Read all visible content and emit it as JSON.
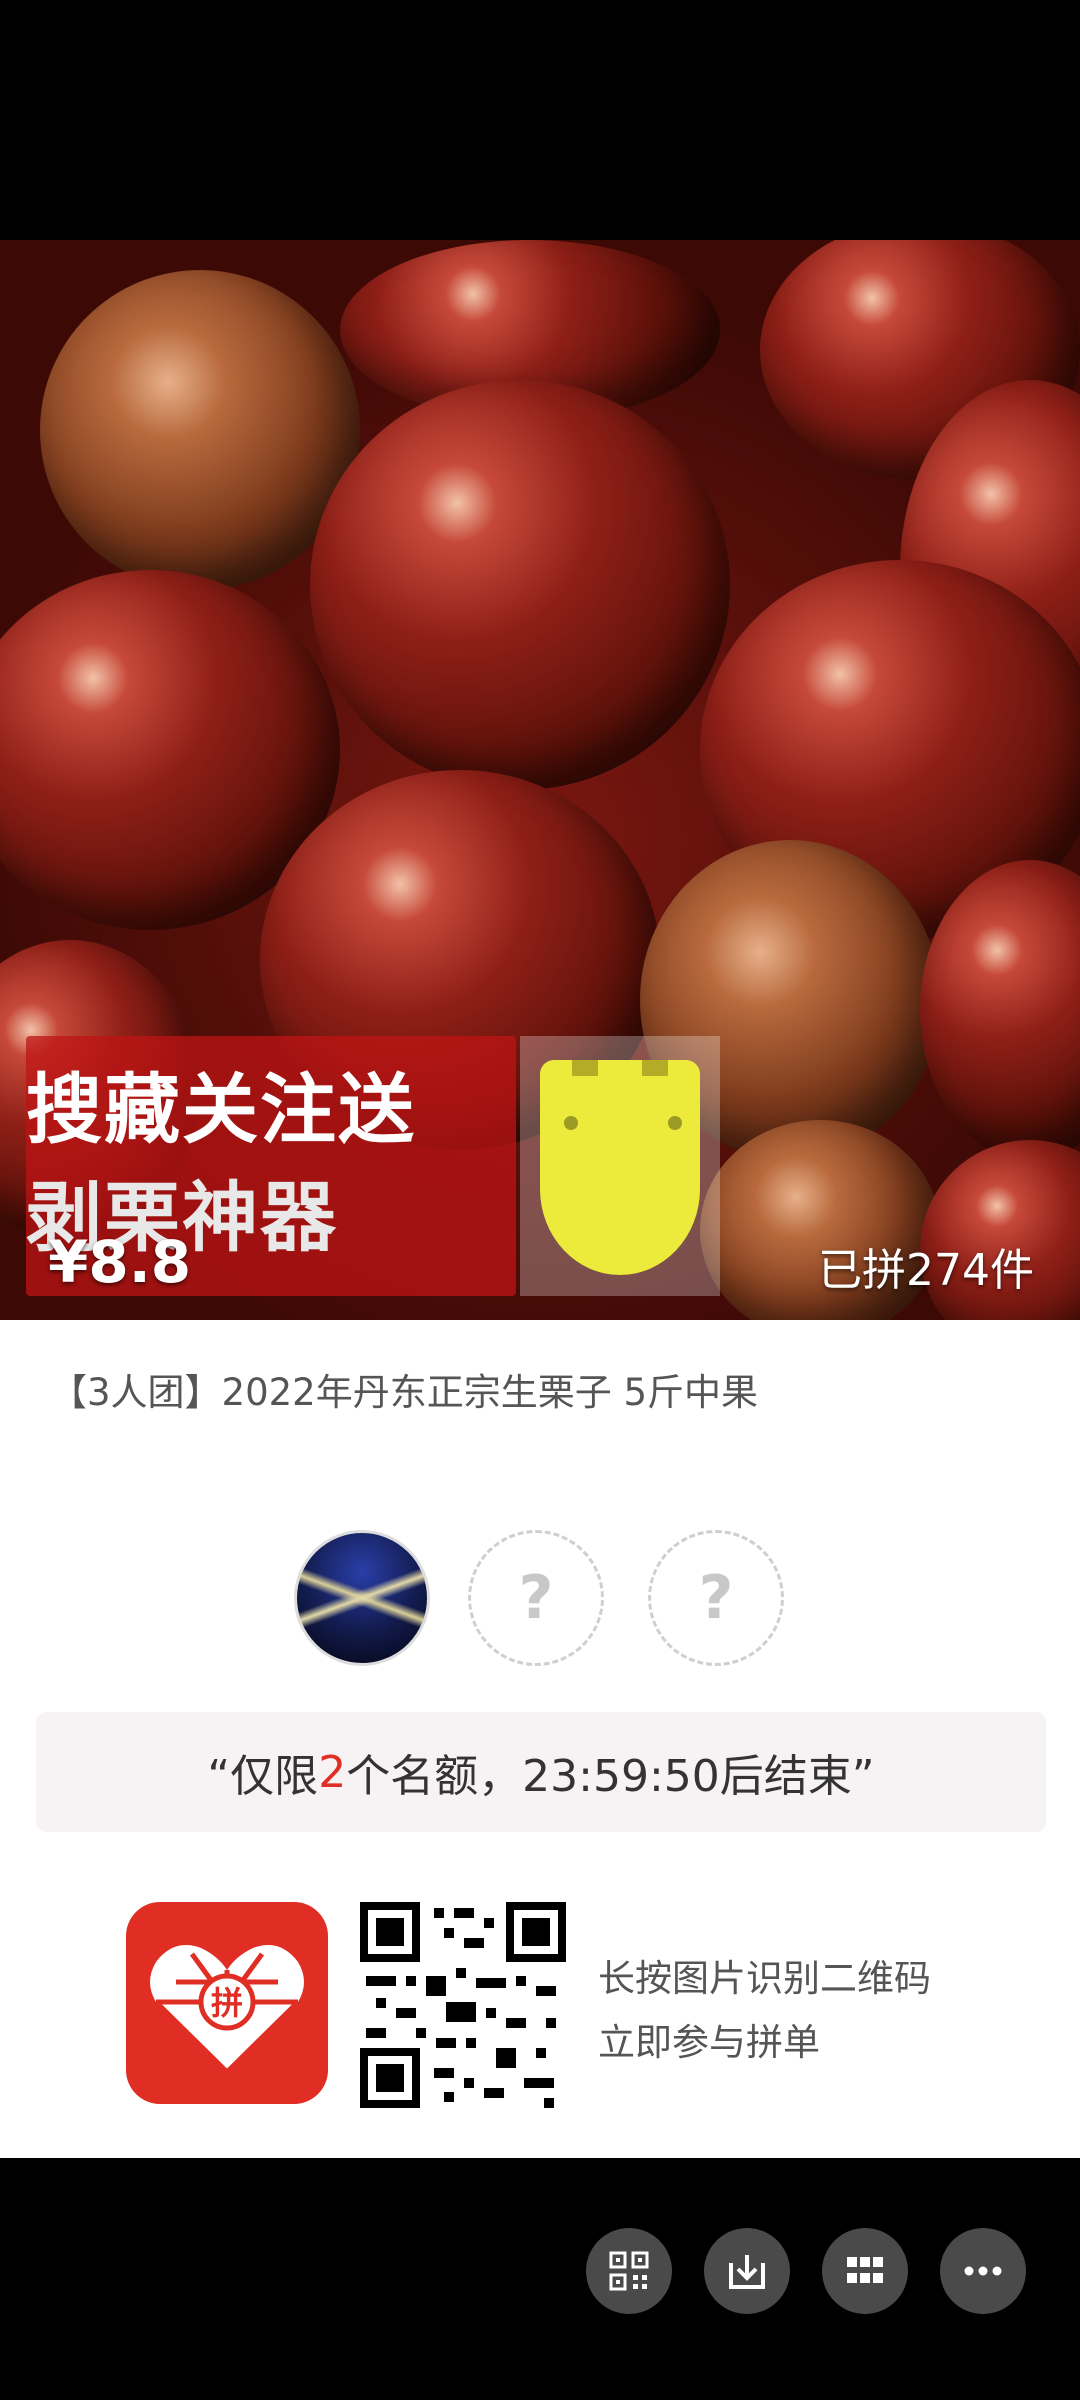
{
  "product": {
    "promo_line1": "搜藏关注送",
    "promo_line2": "剥栗神器",
    "price": "¥8.8",
    "sold": "已拼274件",
    "title": "【3人团】2022年丹东正宗生栗子 5斤中果"
  },
  "group": {
    "empty_slot_mark": "?",
    "notice_prefix": "“仅限",
    "notice_count": "2",
    "notice_suffix": "个名额，23:59:50后结束”"
  },
  "share": {
    "hint_line1": "长按图片识别二维码",
    "hint_line2": "立即参与拼单",
    "app_logo_char": "拼"
  },
  "toolbar": {
    "buttons": [
      {
        "icon": "qr-code-icon"
      },
      {
        "icon": "download-icon"
      },
      {
        "icon": "grid-icon"
      },
      {
        "icon": "more-icon"
      }
    ]
  },
  "colors": {
    "accent_red": "#e02e24",
    "promo_box": "#be1414",
    "tool_yellow": "#ecea3a"
  }
}
